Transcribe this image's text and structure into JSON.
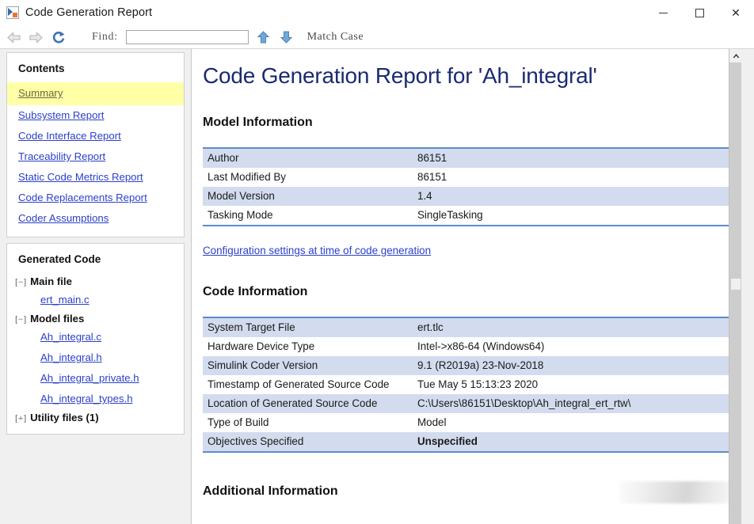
{
  "window": {
    "title": "Code Generation Report",
    "app_icon": "matlab-report-icon",
    "minimize_label": "",
    "maximize_label": "",
    "close_label": "✕"
  },
  "toolbar": {
    "back_icon": "back-arrow-icon",
    "forward_icon": "forward-arrow-icon",
    "refresh_icon": "refresh-icon",
    "find_label": "Find:",
    "find_value": "",
    "find_placeholder": "",
    "find_prev_icon": "arrow-up-icon",
    "find_next_icon": "arrow-down-icon",
    "match_case_label": "Match Case"
  },
  "sidebar": {
    "contents_heading": "Contents",
    "contents_items": [
      {
        "label": "Summary",
        "active": true
      },
      {
        "label": "Subsystem Report",
        "active": false
      },
      {
        "label": "Code Interface Report",
        "active": false
      },
      {
        "label": "Traceability Report",
        "active": false
      },
      {
        "label": "Static Code Metrics Report",
        "active": false
      },
      {
        "label": "Code Replacements Report",
        "active": false
      },
      {
        "label": "Coder Assumptions",
        "active": false
      }
    ],
    "generated_code_heading": "Generated Code",
    "groups": [
      {
        "toggle": "[−]",
        "label": "Main file",
        "files": [
          "ert_main.c"
        ]
      },
      {
        "toggle": "[−]",
        "label": "Model files",
        "files": [
          "Ah_integral.c",
          "Ah_integral.h",
          "Ah_integral_private.h",
          "Ah_integral_types.h"
        ]
      },
      {
        "toggle": "[+]",
        "label": "Utility files (1)",
        "files": []
      }
    ]
  },
  "content": {
    "doc_title": "Code Generation Report for 'Ah_integral'",
    "model_info_heading": "Model Information",
    "model_info_rows": [
      {
        "key": "Author",
        "value": "86151"
      },
      {
        "key": "Last Modified By",
        "value": "86151"
      },
      {
        "key": "Model Version",
        "value": "1.4"
      },
      {
        "key": "Tasking Mode",
        "value": "SingleTasking"
      }
    ],
    "config_link": "Configuration settings at time of code generation",
    "code_info_heading": "Code Information",
    "code_info_rows": [
      {
        "key": "System Target File",
        "value": "ert.tlc",
        "warn": false
      },
      {
        "key": "Hardware Device Type",
        "value": "Intel->x86-64 (Windows64)",
        "warn": false
      },
      {
        "key": "Simulink Coder Version",
        "value": "9.1 (R2019a) 23-Nov-2018",
        "warn": false
      },
      {
        "key": "Timestamp of Generated Source Code",
        "value": "Tue May 5 15:13:23 2020",
        "warn": false
      },
      {
        "key": "Location of Generated Source Code",
        "value": "C:\\Users\\86151\\Desktop\\Ah_integral_ert_rtw\\",
        "warn": false
      },
      {
        "key": "Type of Build",
        "value": "Model",
        "warn": false
      },
      {
        "key": "Objectives Specified",
        "value": "Unspecified",
        "warn": true
      }
    ],
    "additional_info_heading": "Additional Information"
  },
  "colors": {
    "title_blue": "#1a2a73",
    "link_blue": "#2b41c8",
    "row_alt": "#d2dcee",
    "table_border": "#5b8cc8",
    "highlight_yellow": "#ffffa8",
    "warn_orange": "#f0a020"
  }
}
